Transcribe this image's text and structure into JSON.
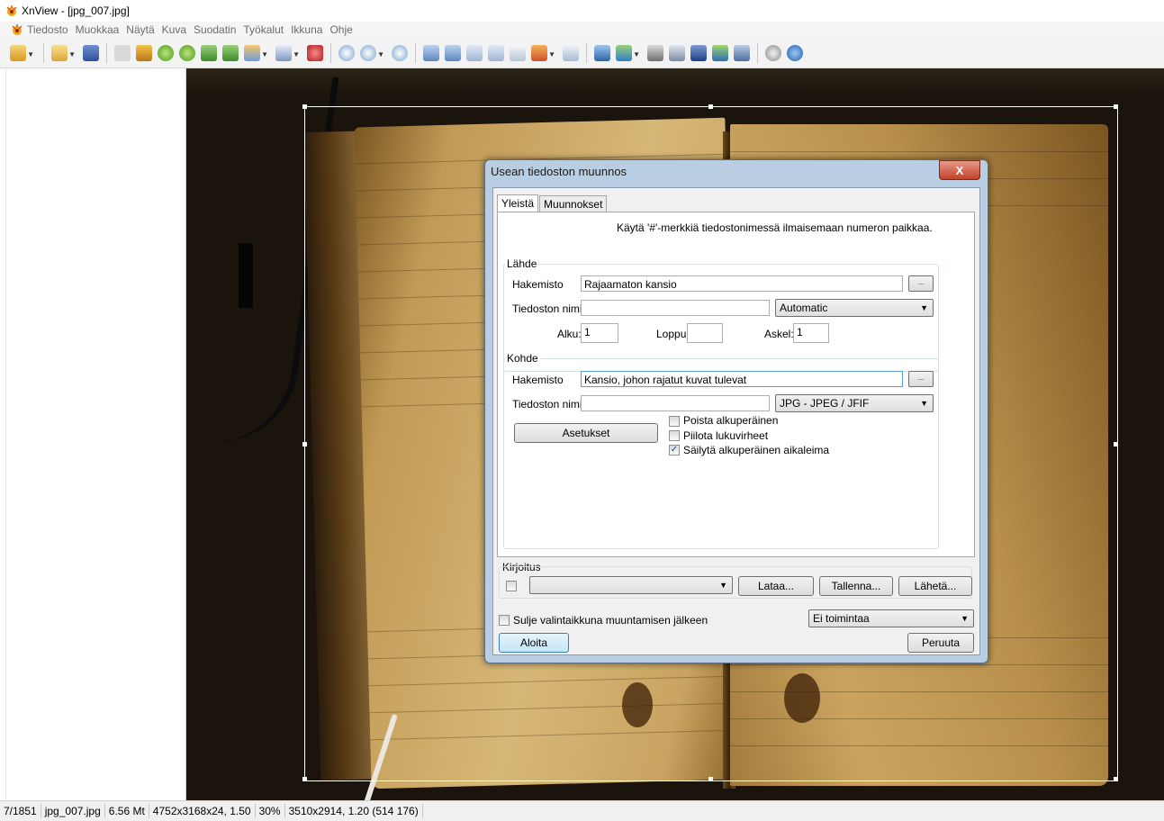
{
  "window": {
    "title": "XnView - [jpg_007.jpg]"
  },
  "menu": [
    "Tiedosto",
    "Muokkaa",
    "Näytä",
    "Kuva",
    "Suodatin",
    "Työkalut",
    "Ikkuna",
    "Ohje"
  ],
  "toolbar": {
    "icons": [
      "browser-icon",
      "open-folder-icon",
      "save-icon",
      "undo-icon",
      "crop-icon",
      "rotate-left-icon",
      "rotate-right-icon",
      "import-icon",
      "export-icon",
      "adjust-icon",
      "list-icon",
      "effects-icon",
      "zoom-in-icon",
      "zoom-icon",
      "zoom-out-icon",
      "previous-icon",
      "next-icon",
      "first-icon",
      "last-icon",
      "copy-icon",
      "slideshow-icon",
      "fullscreen-icon",
      "capture-icon",
      "convert-icon",
      "find-icon",
      "print-icon",
      "scanner-icon",
      "wallpaper-icon",
      "screen-icon",
      "settings-icon",
      "info-icon"
    ]
  },
  "dialog": {
    "title": "Usean tiedoston muunnos",
    "close": "X",
    "tabs": [
      "Yleistä",
      "Muunnokset"
    ],
    "hint": "Käytä '#'-merkkiä tiedostonimessä ilmaisemaan numeron paikkaa.",
    "source": {
      "group_label": "Lähde",
      "folder_label": "Hakemisto",
      "folder_value": "Rajaamaton kansio",
      "filename_label": "Tiedoston nimi",
      "filename_value": "",
      "format": "Automatic",
      "start_label": "Alku:",
      "start_value": "1",
      "end_label": "Loppu",
      "end_value": "",
      "step_label": "Askel:",
      "step_value": "1",
      "browse_label": "..."
    },
    "target": {
      "group_label": "Kohde",
      "folder_label": "Hakemisto",
      "folder_value": "Kansio, johon rajatut kuvat tulevat",
      "filename_label": "Tiedoston nimi",
      "filename_value": "",
      "format": "JPG - JPEG / JFIF",
      "settings_button": "Asetukset",
      "browse_label": "...",
      "options": [
        {
          "label": "Poista alkuperäinen",
          "checked": false
        },
        {
          "label": "Piilota lukuvirheet",
          "checked": false
        },
        {
          "label": "Säilytä alkuperäinen aikaleima",
          "checked": true
        }
      ]
    },
    "script": {
      "group_label": "Kirjoitus",
      "enabled": false,
      "selected": "",
      "load_button": "Lataa...",
      "save_button": "Tallenna...",
      "send_button": "Lähetä..."
    },
    "close_after_label": "Sulje valintaikkuna muuntamisen jälkeen",
    "close_after_checked": false,
    "after_action": "Ei toimintaa",
    "start_button": "Aloita",
    "cancel_button": "Peruuta"
  },
  "status": {
    "index": "7/1851",
    "filename": "jpg_007.jpg",
    "filesize": "6.56 Mt",
    "image_info": "4752x3168x24, 1.50",
    "zoom": "30%",
    "selection": "3510x2914, 1.20 (514 176)"
  },
  "colors": {
    "dialog_frame": "#b9cde3",
    "close_button": "#c2412b",
    "default_button": "#c4e5f6"
  }
}
